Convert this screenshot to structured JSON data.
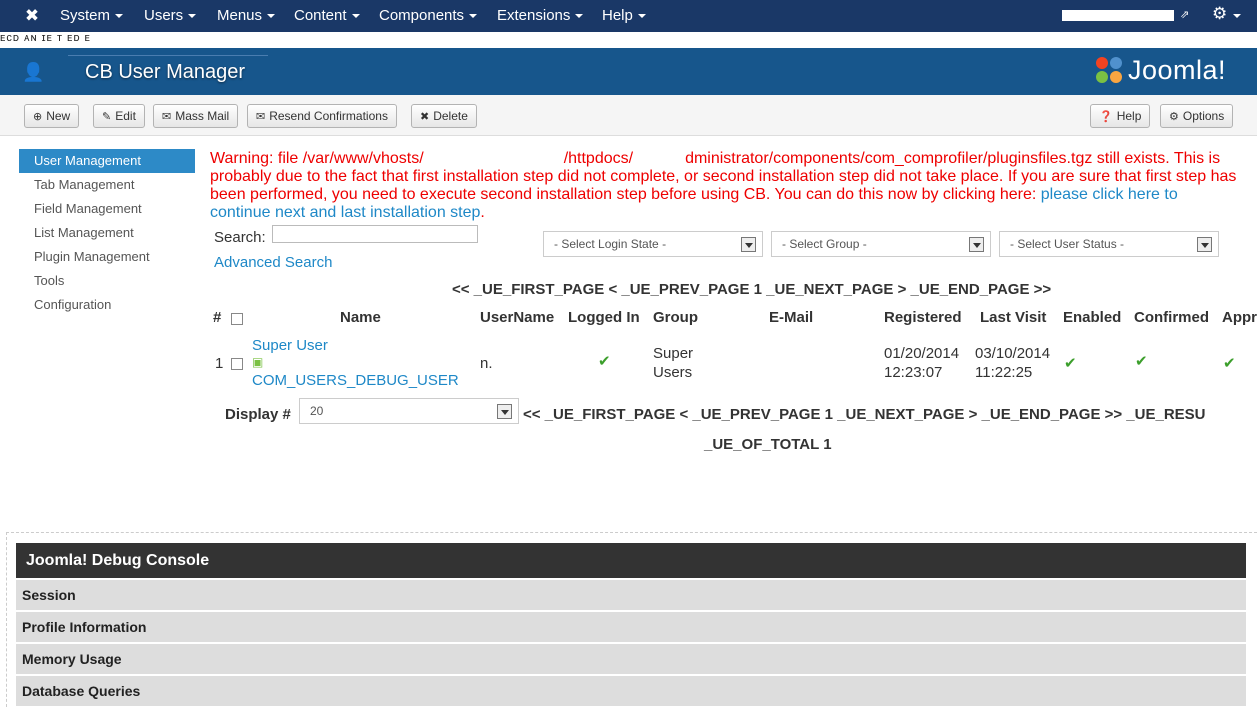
{
  "topnav": {
    "menus": [
      "System",
      "Users",
      "Menus",
      "Content",
      "Components",
      "Extensions",
      "Help"
    ]
  },
  "subbar": {
    "ghost_text": "ᴇᴄᴅ ᴀɴ ɪᴇ ᴛ ᴇᴅ ᴇ"
  },
  "header": {
    "title": "CB User Manager",
    "brand": "Joomla!"
  },
  "toolbar": {
    "new": "New",
    "edit": "Edit",
    "mass_mail": "Mass Mail",
    "resend": "Resend Confirmations",
    "delete": "Delete",
    "help": "Help",
    "options": "Options"
  },
  "sidebar": {
    "items": [
      "User Management",
      "Tab Management",
      "Field Management",
      "List Management",
      "Plugin Management",
      "Tools",
      "Configuration"
    ]
  },
  "warning": {
    "part1": "Warning: file /var/www/vhosts/",
    "part2": "/httpdocs/",
    "part3": "dministrator/components/com_comprofiler/pluginsfiles.tgz still exists. This is probably due to the fact that first installation step did not complete, or second installation step did not take place. If you are sure that first step has been performed, you need to execute second installation step before using CB. You can do this now by clicking here: ",
    "link": "please click here to continue next and last installation step",
    "end": "."
  },
  "search": {
    "label": "Search:",
    "value": "",
    "advanced": "Advanced Search"
  },
  "filters": {
    "login_state": "- Select Login State -",
    "group": "- Select Group -",
    "user_status": "- Select User Status -"
  },
  "pagination_top": "<< _UE_FIRST_PAGE < _UE_PREV_PAGE 1 _UE_NEXT_PAGE > _UE_END_PAGE >>",
  "table": {
    "headers": [
      "#",
      "Name",
      "UserName",
      "Logged In",
      "Group",
      "E-Mail",
      "Registered",
      "Last Visit",
      "Enabled",
      "Confirmed",
      "Appr"
    ],
    "rows": [
      {
        "num": "1",
        "name": "Super User",
        "debug": "COM_USERS_DEBUG_USER",
        "username": "n.",
        "group_line1": "Super",
        "group_line2": "Users",
        "email": "",
        "registered_date": "01/20/2014",
        "registered_time": "12:23:07",
        "lastvisit_date": "03/10/2014",
        "lastvisit_time": "11:22:25"
      }
    ]
  },
  "footer": {
    "display_label": "Display #",
    "display_value": "20",
    "pagination": "<< _UE_FIRST_PAGE < _UE_PREV_PAGE 1 _UE_NEXT_PAGE > _UE_END_PAGE >> _UE_RESU",
    "total": "_UE_OF_TOTAL 1"
  },
  "debug": {
    "title": "Joomla! Debug Console",
    "sections": [
      "Session",
      "Profile Information",
      "Memory Usage",
      "Database Queries"
    ]
  },
  "colors": {
    "navbar": "#1a3867",
    "header": "#17568c",
    "accent": "#2d8ac7",
    "warning": "#e00000",
    "link": "#1e88c7"
  }
}
